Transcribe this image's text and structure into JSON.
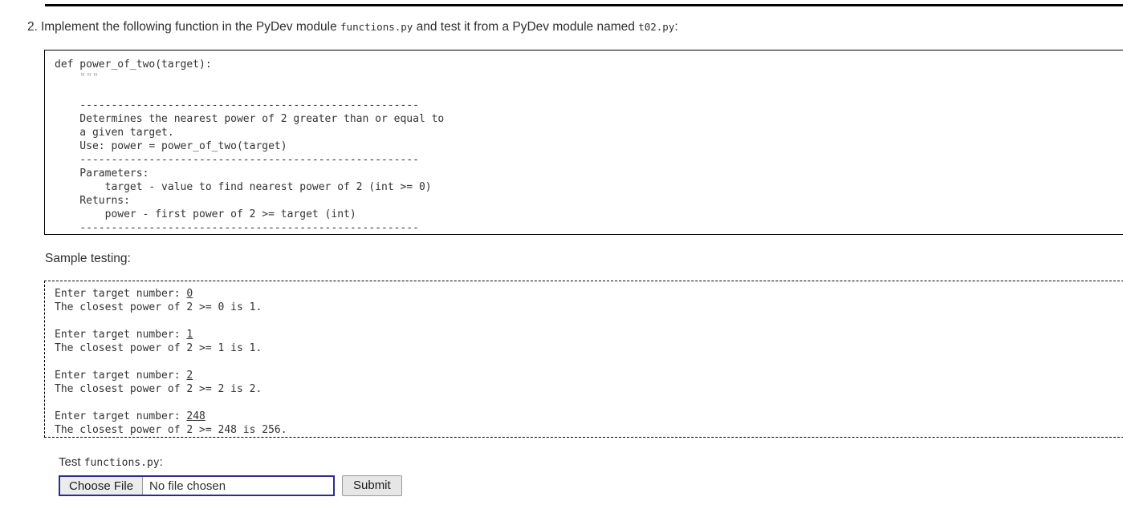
{
  "question": {
    "number": "2.",
    "text_before_module": "Implement the following function in the PyDev module",
    "module_name": "functions.py",
    "text_middle": "and test it from a PyDev module named",
    "test_module_name": "t02.py",
    "text_end": ":"
  },
  "code_block": {
    "lines": "def power_of_two(target):\n    \"\"\"\n\n    ------------------------------------------------------\n    Determines the nearest power of 2 greater than or equal to\n    a given target.\n    Use: power = power_of_two(target)\n    ------------------------------------------------------\n    Parameters:\n        target - value to find nearest power of 2 (int >= 0)\n    Returns:\n        power - first power of 2 >= target (int)\n    ------------------------------------------------------\n    \"\"\""
  },
  "sample": {
    "label": "Sample testing:",
    "runs": [
      {
        "prompt": "Enter target number: ",
        "input": "0",
        "output": "The closest power of 2 >= 0 is 1."
      },
      {
        "prompt": "Enter target number: ",
        "input": "1",
        "output": "The closest power of 2 >= 1 is 1."
      },
      {
        "prompt": "Enter target number: ",
        "input": "2",
        "output": "The closest power of 2 >= 2 is 2."
      },
      {
        "prompt": "Enter target number: ",
        "input": "248",
        "output": "The closest power of 2 >= 248 is 256."
      }
    ]
  },
  "form": {
    "label_prefix": "Test ",
    "label_file": "functions.py",
    "label_suffix": ":",
    "choose_file_label": "Choose File",
    "file_status": "No file chosen",
    "submit_label": "Submit"
  },
  "colors": {
    "focus_border": "#2c2c8f",
    "rule": "#000000",
    "text": "#2f2f2f"
  }
}
